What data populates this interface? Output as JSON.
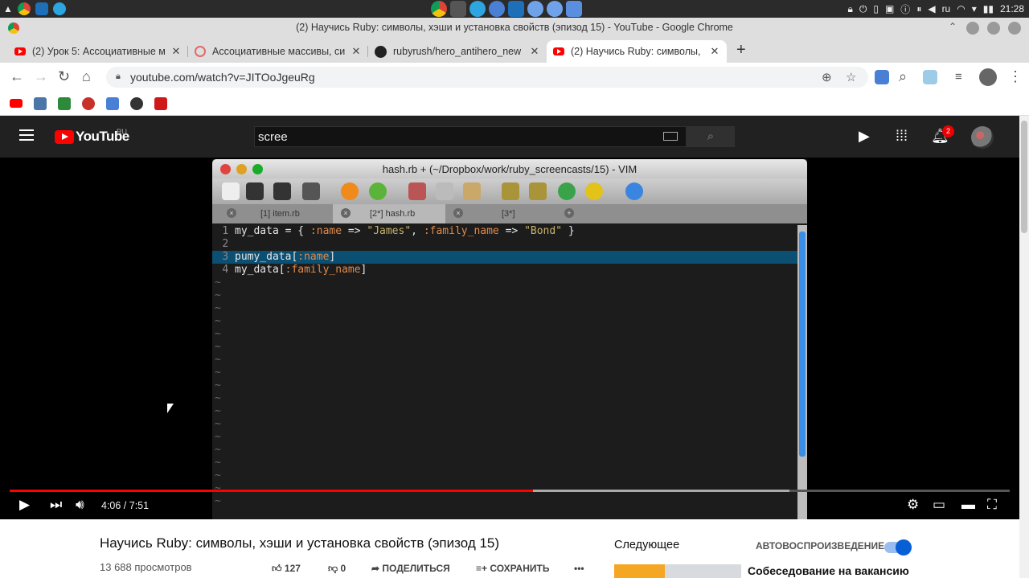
{
  "system": {
    "menu_glyph": "▲",
    "tray_locale": "ru",
    "clock": "21:28"
  },
  "window": {
    "title": "(2) Научись Ruby: символы, хэши и установка свойств (эпизод 15) - YouTube - Google Chrome"
  },
  "tabs": [
    {
      "label": "(2) Урок 5: Ассоциативные м",
      "icon": "youtube-icon"
    },
    {
      "label": "Ассоциативные массивы, си",
      "icon": "site-icon"
    },
    {
      "label": "rubyrush/hero_antihero_new",
      "icon": "github-icon"
    },
    {
      "label": "(2) Научись Ruby: символы, ",
      "icon": "youtube-icon",
      "active": true
    }
  ],
  "new_tab": "+",
  "address": {
    "url": "youtube.com/watch?v=JITOoJgeuRg"
  },
  "youtube": {
    "logo_word": "YouTube",
    "region": "RU",
    "search_value": "scree",
    "notification_count": "2"
  },
  "vim": {
    "window_title": "hash.rb + (~/Dropbox/work/ruby_screencasts/15) - VIM",
    "tabs": [
      "[1] item.rb",
      "[2*] hash.rb",
      "[3*]"
    ],
    "lines": [
      {
        "num": "1",
        "parts": [
          {
            "t": "my_data = { ",
            "c": "id"
          },
          {
            "t": ":name",
            "c": "sym"
          },
          {
            "t": " => ",
            "c": "id"
          },
          {
            "t": "\"James\"",
            "c": "str"
          },
          {
            "t": ", ",
            "c": "id"
          },
          {
            "t": ":family_name",
            "c": "sym"
          },
          {
            "t": " => ",
            "c": "id"
          },
          {
            "t": "\"Bond\"",
            "c": "str"
          },
          {
            "t": " }",
            "c": "id"
          }
        ]
      },
      {
        "num": "2",
        "parts": []
      },
      {
        "num": "3",
        "parts": [
          {
            "t": "pumy_data[",
            "c": "id"
          },
          {
            "t": ":name",
            "c": "sym"
          },
          {
            "t": "]",
            "c": "id"
          }
        ],
        "highlight": true
      },
      {
        "num": "4",
        "parts": [
          {
            "t": "my_data[",
            "c": "id"
          },
          {
            "t": ":family_name",
            "c": "sym"
          },
          {
            "t": "]",
            "c": "id"
          }
        ]
      }
    ],
    "tilde": "~"
  },
  "player": {
    "time": "4:06 / 7:51",
    "played_fraction": 0.523,
    "loaded_fraction": 0.78
  },
  "video": {
    "title": "Научись Ruby: символы, хэши и установка свойств (эпизод 15)",
    "views": "13 688 просмотров",
    "likes": "127",
    "dislikes": "0",
    "share_label": "ПОДЕЛИТЬСЯ",
    "save_label": "СОХРАНИТЬ",
    "more": "•••"
  },
  "sidebar": {
    "next_label": "Следующее",
    "autoplay_label": "АВТОВОСПРОИЗВЕДЕНИЕ",
    "autoplay_on": true,
    "rec_title": "Собеседование на вакансию"
  },
  "colors": {
    "youtube_red": "#ff0000",
    "vim_highlight": "#0b4f72",
    "symbol": "#e08a4a",
    "string": "#c9b26a",
    "accent_blue": "#065fd4"
  }
}
